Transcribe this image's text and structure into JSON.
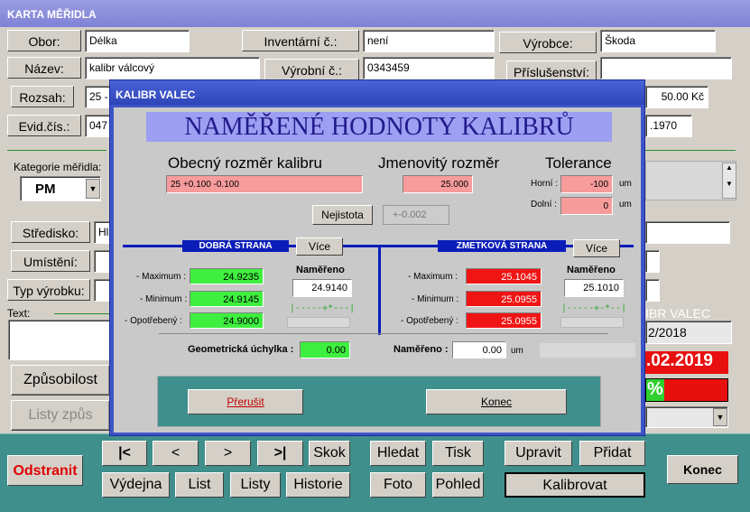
{
  "window": {
    "title": "KARTA MĚŘIDLA"
  },
  "form": {
    "obor_label": "Obor:",
    "obor_value": "Délka",
    "inventarni_label": "Inventární č.:",
    "inventarni_value": "není",
    "vyrobce_label": "Výrobce:",
    "vyrobce_value": "Škoda",
    "nazev_label": "Název:",
    "nazev_value": "kalibr válcový",
    "vyrobni_label": "Výrobní č.:",
    "vyrobni_value": "0343459",
    "prislusenstvi_label": "Příslušenství:",
    "prislusenstvi_value": "",
    "rozsah_label": "Rozsah:",
    "rozsah_value": "25 -",
    "price_value": "50.00 Kč",
    "evid_label": "Evid.čís.:",
    "evid_value": "047",
    "evid_right_value": ".1970",
    "kategorie_label": "Kategorie měřidla:",
    "kategorie_value": "PM",
    "stredisko_label": "Středisko:",
    "stredisko_value": "Hl",
    "umisteni_label": "Umístění:",
    "typ_label": "Typ výrobku:",
    "text_label": "Text:",
    "zpusobilost_label": "Způsobilost",
    "listy_label": "Listy způs",
    "kalibr_right": "IBR VALEC",
    "date1": "2/2018",
    "date2": ".02.2019",
    "percent": "%"
  },
  "dialog": {
    "title": "KALIBR VALEC",
    "header": "NAMĚŘENÉ HODNOTY KALIBRŮ",
    "obecny_label": "Obecný rozměr kalibru",
    "obecny_value": "25 +0.100 -0.100",
    "jmenovity_label": "Jmenovitý rozměr",
    "jmenovity_value": "25.000",
    "tolerance_label": "Tolerance",
    "horni_label": "Horní :",
    "horni_value": "-100",
    "dolni_label": "Dolní :",
    "dolni_value": "0",
    "um": "um",
    "nejistota_label": "Nejistota",
    "nejistota_value": "+-0.002",
    "dobra_label": "DOBRÁ STRANA",
    "zmetkova_label": "ZMETKOVÁ STRANA",
    "vice_label": "Více",
    "maximum_label": "- Maximum :",
    "minimum_label": "- Minimum :",
    "opotrebeny_label": "- Opotřebený :",
    "nameno_label": "Naměřeno",
    "good": {
      "max": "24.9235",
      "min": "24.9145",
      "opot": "24.9000",
      "meas": "24.9140",
      "gauge": "|-----+*---|"
    },
    "bad": {
      "max": "25.1045",
      "min": "25.0955",
      "opot": "25.0955",
      "meas": "25.1010",
      "gauge": "|-----+-*--|"
    },
    "geom_label": "Geometrická úchylka :",
    "geom_value": "0.00",
    "nameno2_label": "Naměřeno :",
    "nameno2_value": "0.00",
    "prerusit_label": "Přerušit",
    "konec_label": "Konec"
  },
  "bottom": {
    "odstranit": "Odstranit",
    "first": "|<",
    "prev": "<",
    "next": ">",
    "last": ">|",
    "skok": "Skok",
    "hledat": "Hledat",
    "tisk": "Tisk",
    "upravit": "Upravit",
    "pridat": "Přidat",
    "konec": "Konec",
    "vydejna": "Výdejna",
    "list": "List",
    "listy": "Listy",
    "historie": "Historie",
    "foto": "Foto",
    "pohled": "Pohled",
    "kalibrovat": "Kalibrovat"
  },
  "colors": {
    "good": "#3fef3f",
    "bad": "#f01515",
    "accent": "#0b1db8"
  }
}
